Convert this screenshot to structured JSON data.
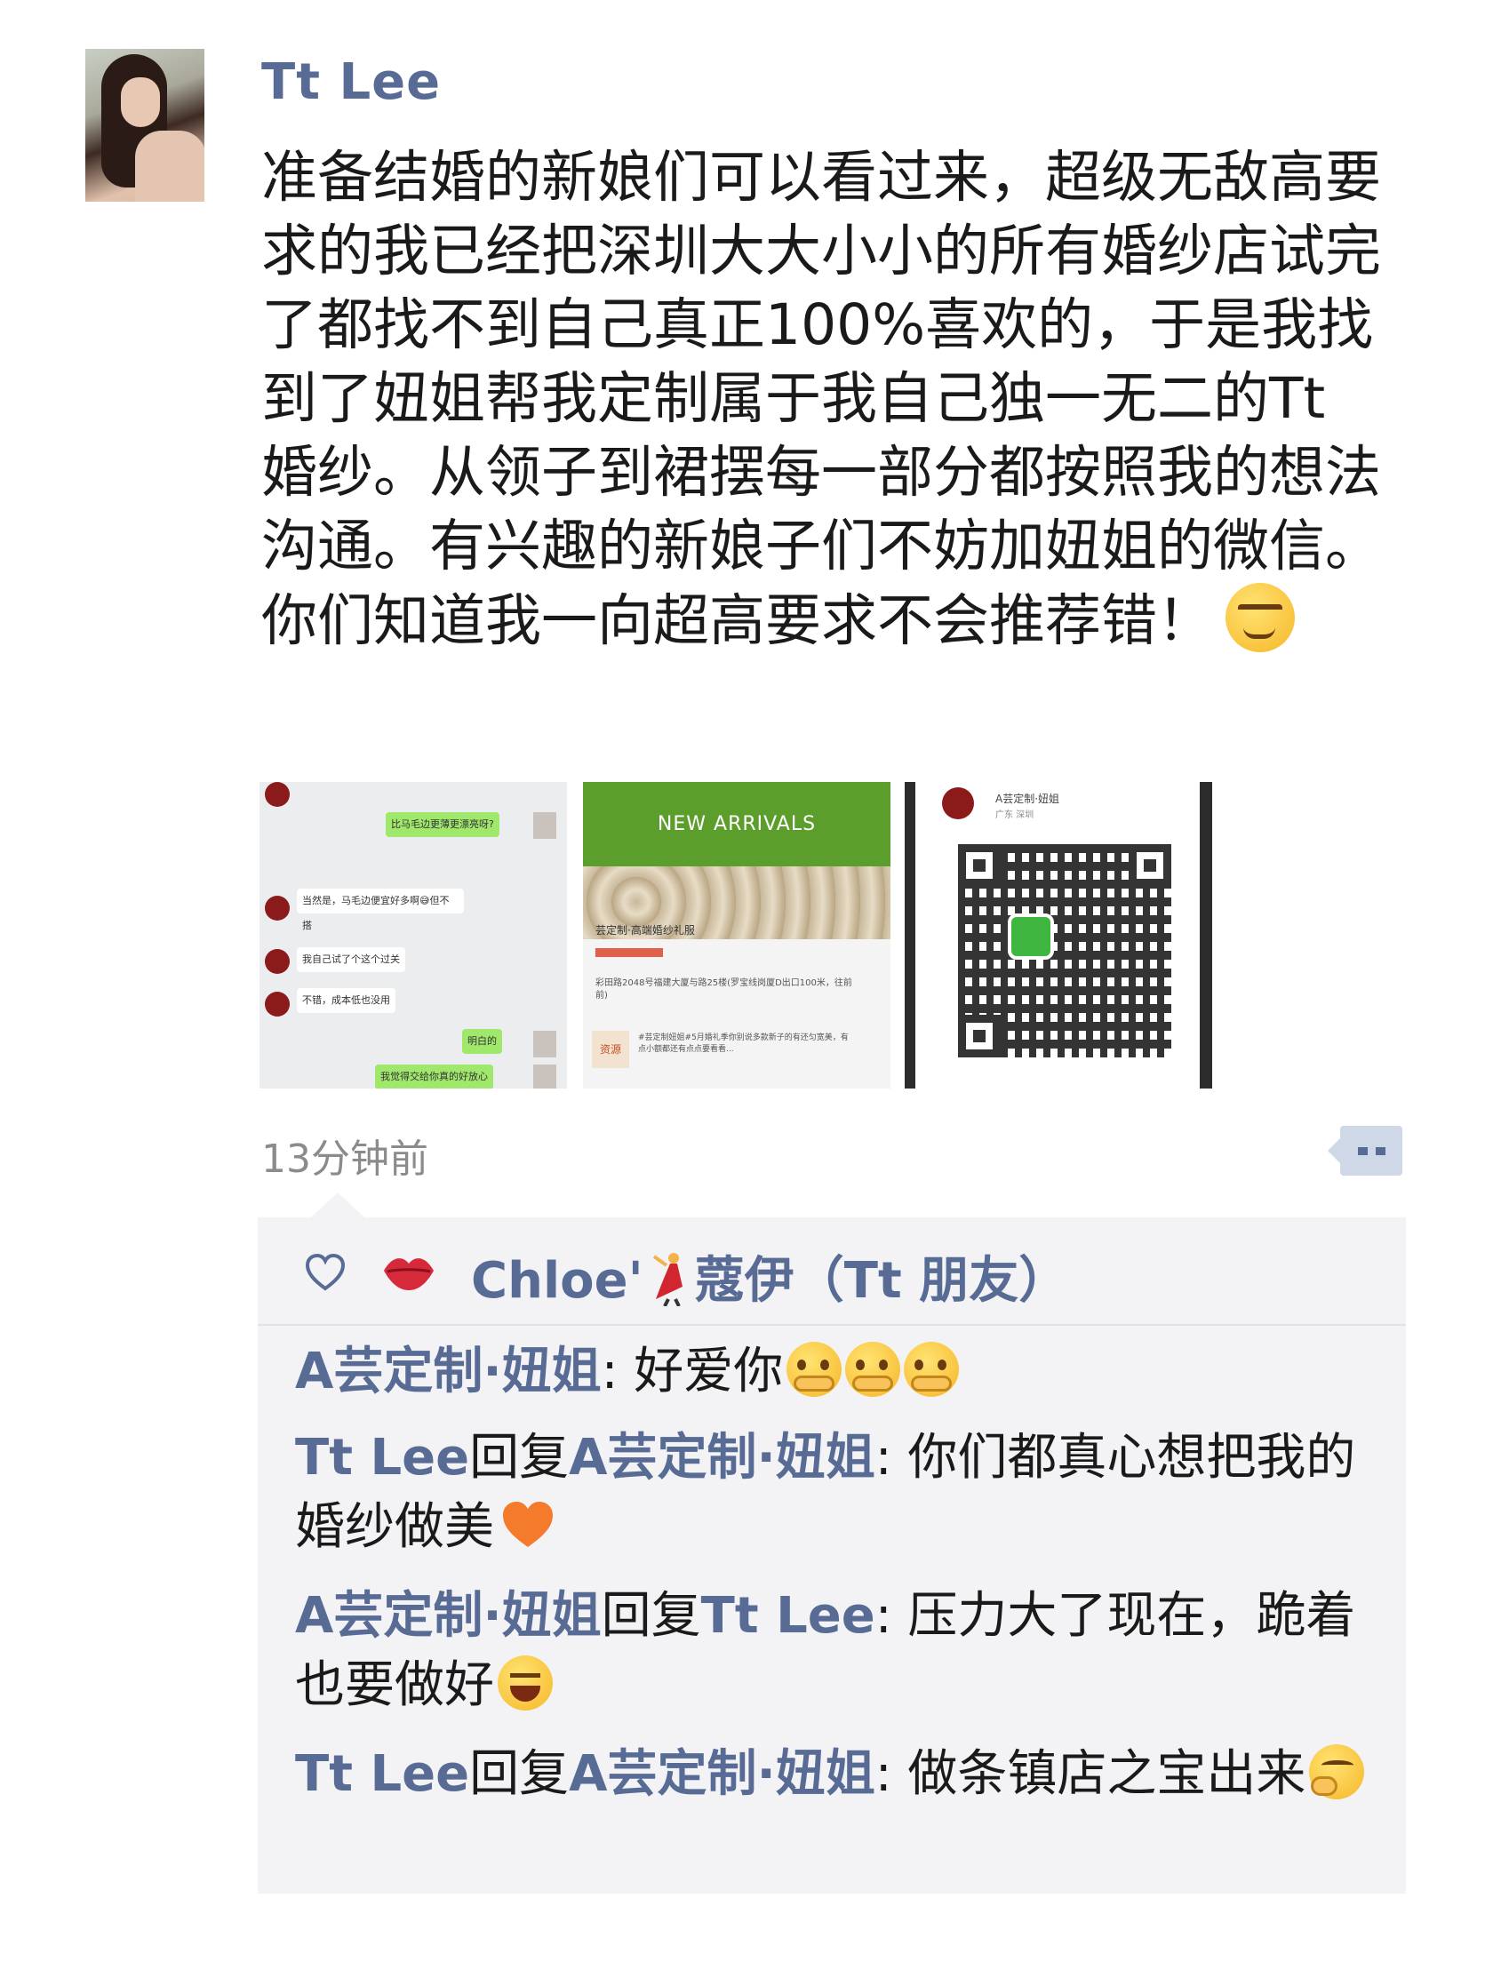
{
  "post": {
    "author": "Tt Lee",
    "text": "准备结婚的新娘们可以看过来，超级无敌高要求的我已经把深圳大大小小的所有婚纱店试完了都找不到自己真正100%喜欢的，于是我找到了妞姐帮我定制属于我自己独一无二的Tt婚纱。从领子到裙摆每一部分都按照我的想法沟通。有兴趣的新娘子们不妨加妞姐的微信。你们知道我一向超高要求不会推荐错！",
    "text_emoji": "smirk-emoji",
    "time": "13分钟前"
  },
  "images": {
    "chat": {
      "bubbles": [
        "比马毛边更薄更漂亮呀?",
        "当然是，马毛边便宜好多啊😅但不搭",
        "我自己试了个这个过关",
        "不错，成本低也没用",
        "明白的",
        "我觉得交给你真的好放心"
      ]
    },
    "shop": {
      "banner": "NEW ARRIVALS",
      "name": "芸定制·高端婚纱礼服",
      "address": "彩田路2048号福建大厦与路25楼(罗宝线岗厦D出口100米，往前前)",
      "badge": "资源",
      "promo": "#芸定制妞姐#5月婚礼季你别说多款新子的有还匀宽美，有点小额都还有点点要看看..."
    },
    "qr": {
      "title": "A芸定制·妞姐",
      "subtitle": "广东 深圳"
    }
  },
  "likes": {
    "names": [
      "Chloe'",
      "蔻伊（Tt 朋友）"
    ]
  },
  "comments": [
    {
      "author": "A芸定制·妞姐",
      "text": ": 好爱你",
      "emoji": [
        "hug-emoji",
        "hug-emoji",
        "hug-emoji"
      ]
    },
    {
      "author": "Tt Lee",
      "reply_word": "回复",
      "target": "A芸定制·妞姐",
      "text": ": 你们都真心想把我的婚纱做美",
      "emoji": [
        "orange-heart-emoji"
      ]
    },
    {
      "author": "A芸定制·妞姐",
      "reply_word": "回复",
      "target": "Tt Lee",
      "text": ": 压力大了现在，跪着也要做好",
      "emoji": [
        "laughing-tears-emoji"
      ]
    },
    {
      "author": "Tt Lee",
      "reply_word": "回复",
      "target": "A芸定制·妞姐",
      "text": ": 做条镇店之宝出来",
      "emoji": [
        "thinking-emoji"
      ]
    }
  ],
  "colors": {
    "name_blue": "#576b95",
    "comment_bg": "#f3f3f5",
    "time_gray": "#8b8b8b"
  }
}
